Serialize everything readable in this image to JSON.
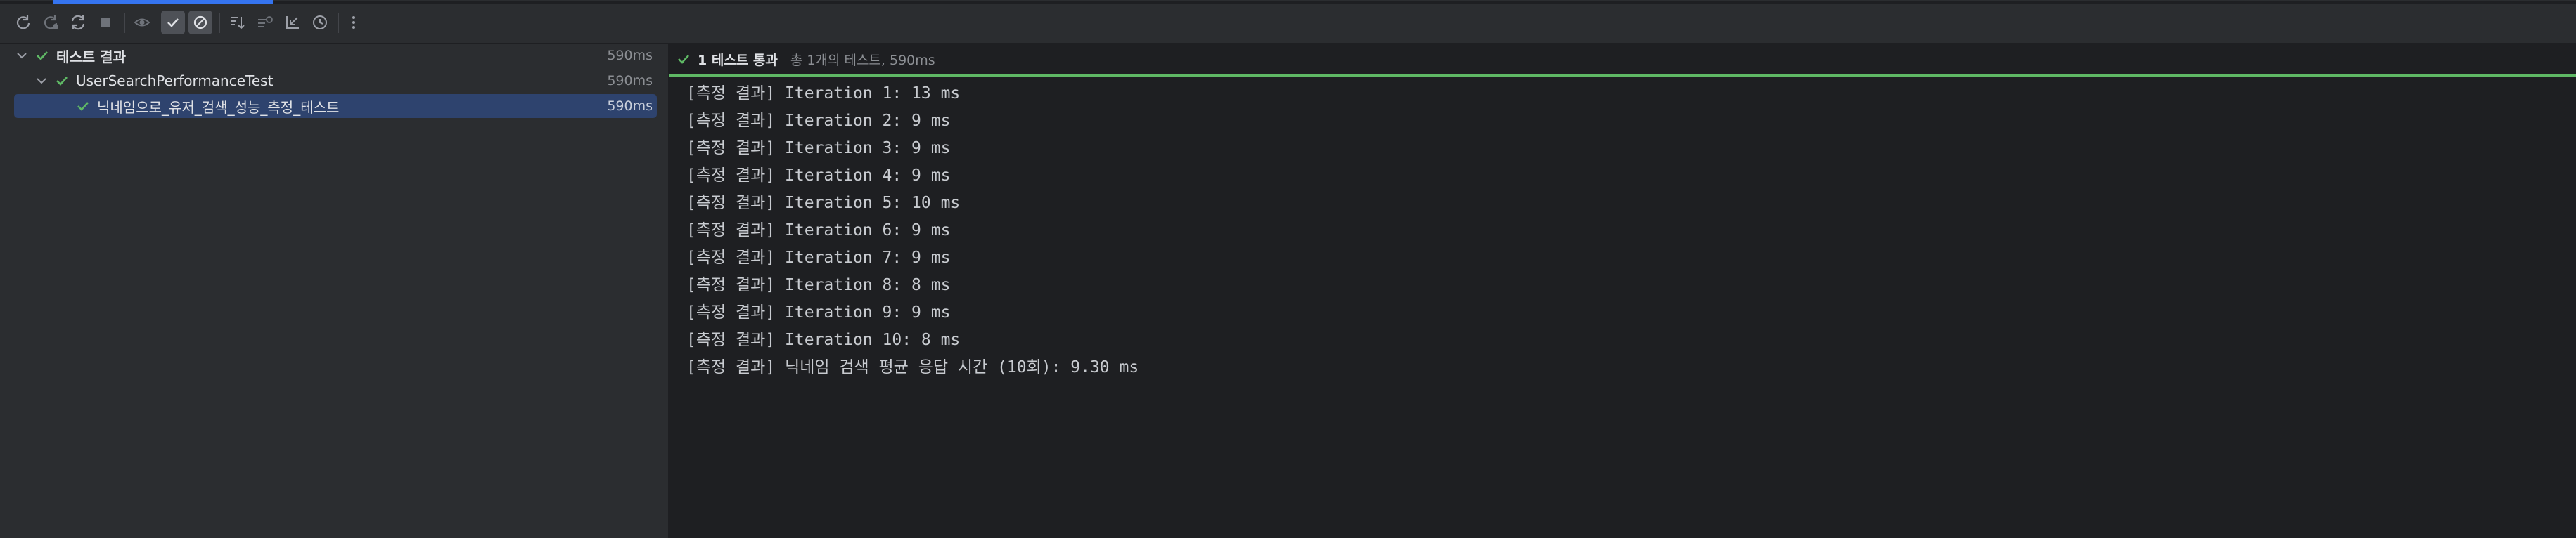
{
  "toolbar": {
    "buttons": [
      {
        "icon": "rerun-icon"
      },
      {
        "icon": "rerun-failed-icon"
      },
      {
        "icon": "toggle-auto-test-icon"
      },
      {
        "icon": "stop-icon"
      },
      {
        "icon": "show-ignored-icon"
      },
      {
        "icon": "show-passed-icon"
      },
      {
        "icon": "show-ignored-toggle-icon"
      },
      {
        "icon": "sort-alphabetically-icon"
      },
      {
        "icon": "sort-by-duration-icon"
      },
      {
        "icon": "import-tests-icon"
      },
      {
        "icon": "history-icon"
      },
      {
        "icon": "more-options-icon"
      }
    ]
  },
  "tree": {
    "root": {
      "label": "테스트 결과",
      "time": "590ms"
    },
    "class": {
      "label": "UserSearchPerformanceTest",
      "time": "590ms"
    },
    "test": {
      "label": "닉네임으로_유저_검색_성능_측정_테스트",
      "time": "590ms"
    }
  },
  "status": {
    "main": "1 테스트 통과",
    "sub": "총 1개의 테스트, 590ms"
  },
  "console": {
    "lines": [
      "[측정 결과] Iteration 1: 13 ms",
      "[측정 결과] Iteration 2: 9 ms",
      "[측정 결과] Iteration 3: 9 ms",
      "[측정 결과] Iteration 4: 9 ms",
      "[측정 결과] Iteration 5: 10 ms",
      "[측정 결과] Iteration 6: 9 ms",
      "[측정 결과] Iteration 7: 9 ms",
      "[측정 결과] Iteration 8: 8 ms",
      "[측정 결과] Iteration 9: 9 ms",
      "[측정 결과] Iteration 10: 8 ms",
      "[측정 결과] 닉네임 검색 평균 응답 시간 (10회): 9.30 ms"
    ]
  },
  "colors": {
    "accent": "#3574f0",
    "pass": "#5fb865",
    "selection": "#2e436e"
  }
}
